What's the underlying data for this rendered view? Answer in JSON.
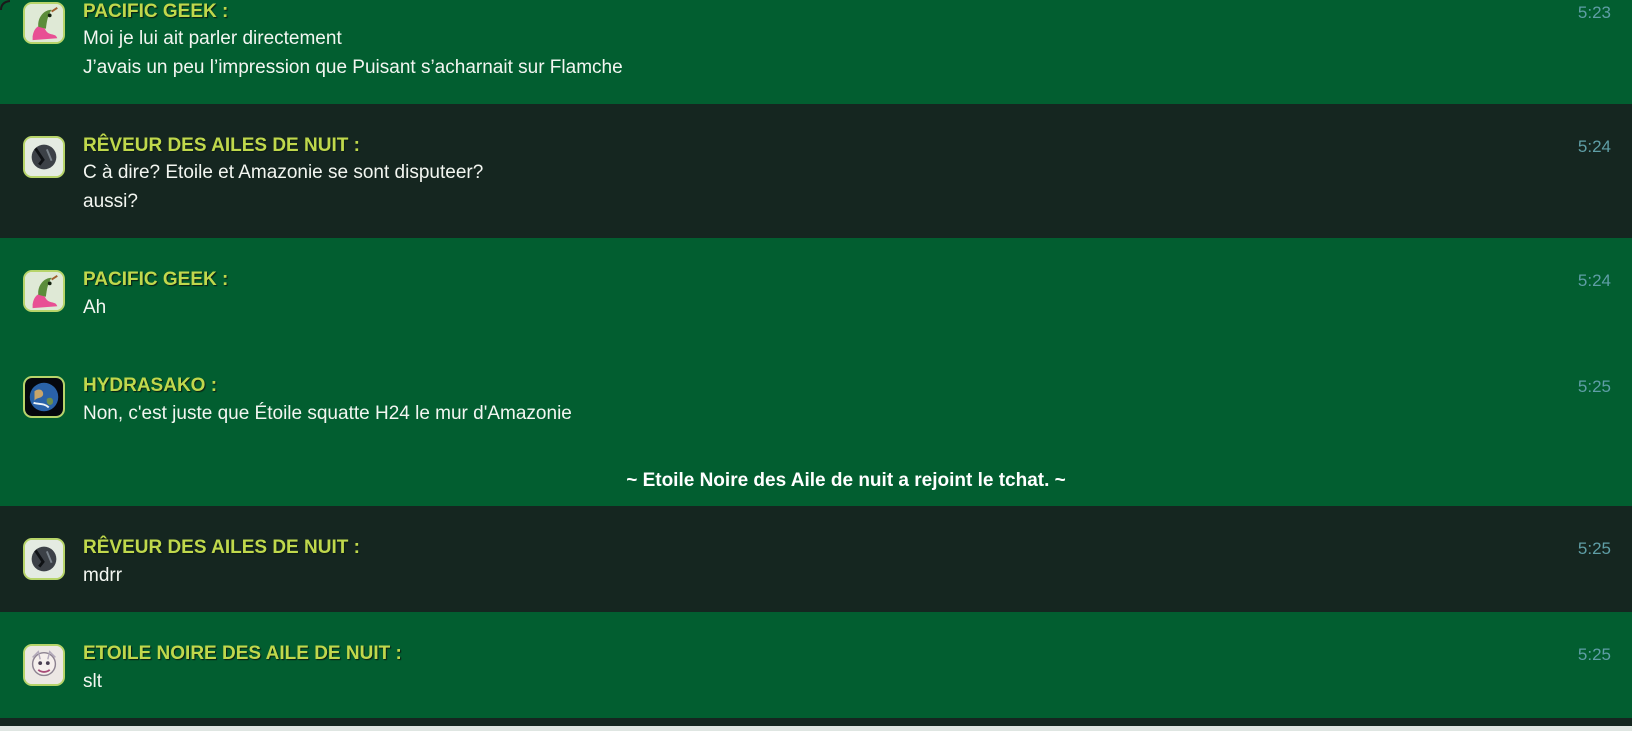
{
  "colors": {
    "row_green": "#025e30",
    "row_dark": "#152620",
    "author": "#c0d84c",
    "text": "#f3f6f1",
    "time": "#5f9ea6"
  },
  "messages": [
    {
      "author": "PACIFIC GEEK :",
      "time": "5:23",
      "avatar_icon": "pink-bird-avatar-icon",
      "lines": [
        "Moi je lui ait parler directement",
        "J’avais un peu l’impression que Puisant s’acharnait sur Flamche"
      ]
    },
    {
      "author": "RÊVEUR DES AILES DE NUIT :",
      "time": "5:24",
      "avatar_icon": "dark-dragon-avatar-icon",
      "lines": [
        "C à dire? Etoile et Amazonie se sont disputeer?",
        "aussi?"
      ]
    },
    {
      "author": "PACIFIC GEEK :",
      "time": "5:24",
      "avatar_icon": "pink-bird-avatar-icon",
      "lines": [
        "Ah"
      ]
    },
    {
      "author": "HYDRASAKO :",
      "time": "5:25",
      "avatar_icon": "earth-globe-avatar-icon",
      "lines": [
        "Non, c'est juste que Étoile squatte H24 le mur d'Amazonie"
      ]
    },
    {
      "author": "RÊVEUR DES AILES DE NUIT :",
      "time": "5:25",
      "avatar_icon": "dark-dragon-avatar-icon",
      "lines": [
        "mdrr"
      ]
    },
    {
      "author": "ETOILE NOIRE DES AILE DE NUIT :",
      "time": "5:25",
      "avatar_icon": "sketch-creature-avatar-icon",
      "lines": [
        "slt"
      ]
    }
  ],
  "system_message": "~ Etoile Noire des Aile de nuit a rejoint le tchat. ~"
}
